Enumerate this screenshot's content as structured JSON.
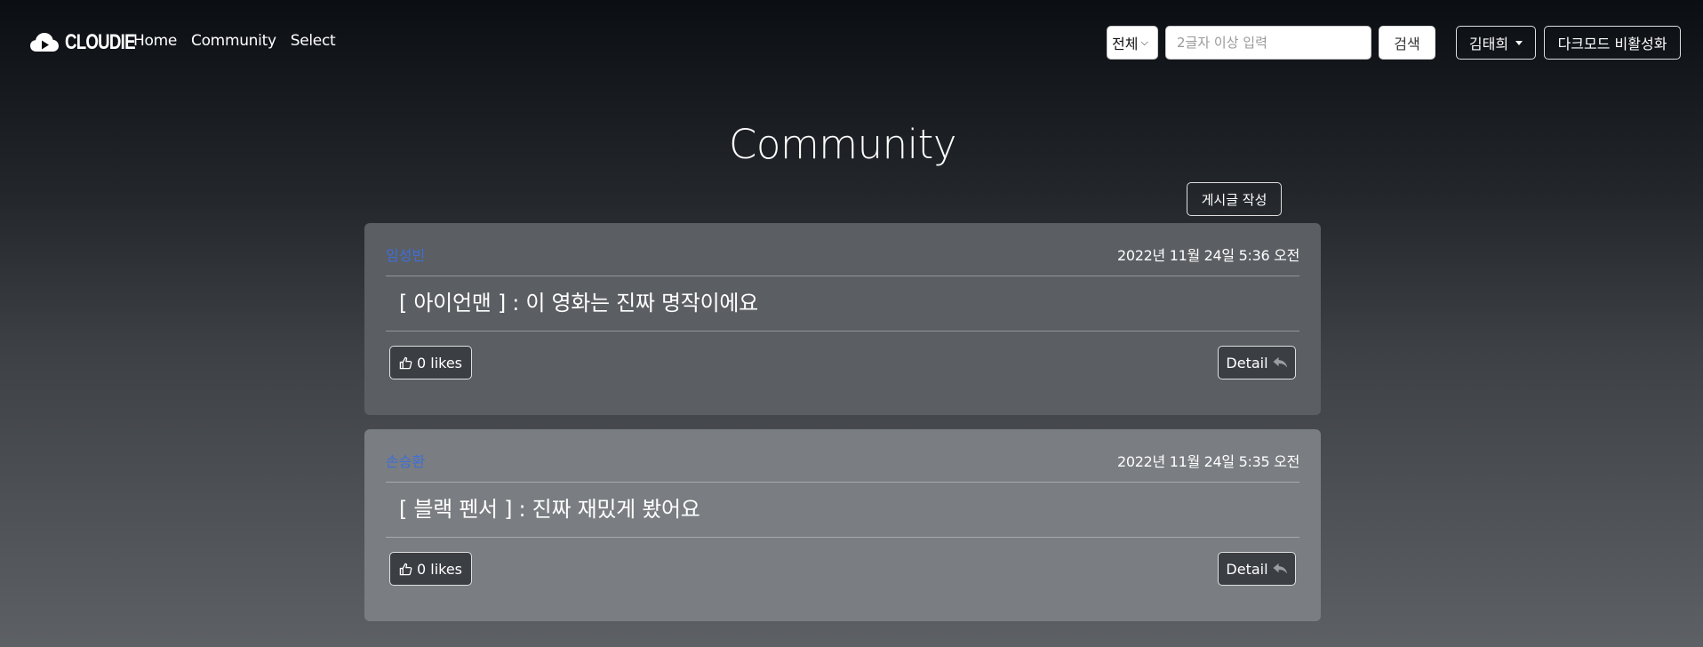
{
  "navbar": {
    "brand": "CLOUDIE",
    "links": [
      "Home",
      "Community",
      "Select"
    ],
    "search": {
      "select_value": "전체",
      "placeholder": "2글자 이상 입력",
      "button_label": "검색"
    },
    "user_name": "김태희",
    "dark_mode_label": "다크모드 비활성화"
  },
  "page": {
    "title": "Community",
    "write_button_label": "게시글 작성"
  },
  "posts": [
    {
      "author": "임성빈",
      "date": "2022년 11월 24일 5:36 오전",
      "title": "[ 아이언맨 ] : 이 영화는 진짜 명작이에요",
      "likes_label": "0 likes",
      "detail_label": "Detail"
    },
    {
      "author": "손승환",
      "date": "2022년 11월 24일 5:35 오전",
      "title": "[ 블랙 펜서 ] : 진짜 재밌게 봤어요",
      "likes_label": "0 likes",
      "detail_label": "Detail"
    }
  ],
  "icons": {
    "brand_logo": "cloud-play-icon",
    "like": "thumbs-up-icon",
    "detail": "reply-arrow-icon"
  },
  "colors": {
    "author_link": "#3d6fd9",
    "button_dark": "#3b3e43"
  }
}
